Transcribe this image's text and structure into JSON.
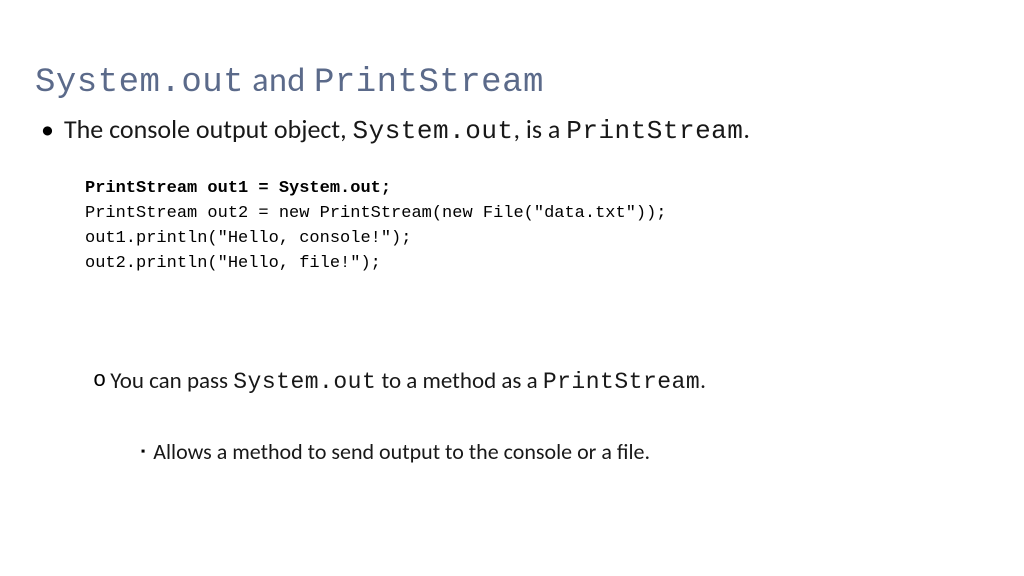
{
  "title": {
    "part1": "System.out",
    "and": " and ",
    "part2": "PrintStream"
  },
  "bullet1": {
    "t1": "The console output object, ",
    "t2": "System.out",
    "t3": ", is a ",
    "t4": "PrintStream",
    "t5": "."
  },
  "code": {
    "l1": "PrintStream out1 = System.out;",
    "l2": "PrintStream out2 = new PrintStream(new File(\"data.txt\"));",
    "l3": "out1.println(\"Hello, console!\");",
    "l4": "out2.println(\"Hello, file!\");"
  },
  "sub": {
    "marker": "o",
    "t1": "You can pass ",
    "t2": "System.out",
    "t3": " to a method as a ",
    "t4": "PrintStream",
    "t5": "."
  },
  "subsub": {
    "marker": "▪",
    "text": "Allows a method to send output to the console or a file."
  }
}
